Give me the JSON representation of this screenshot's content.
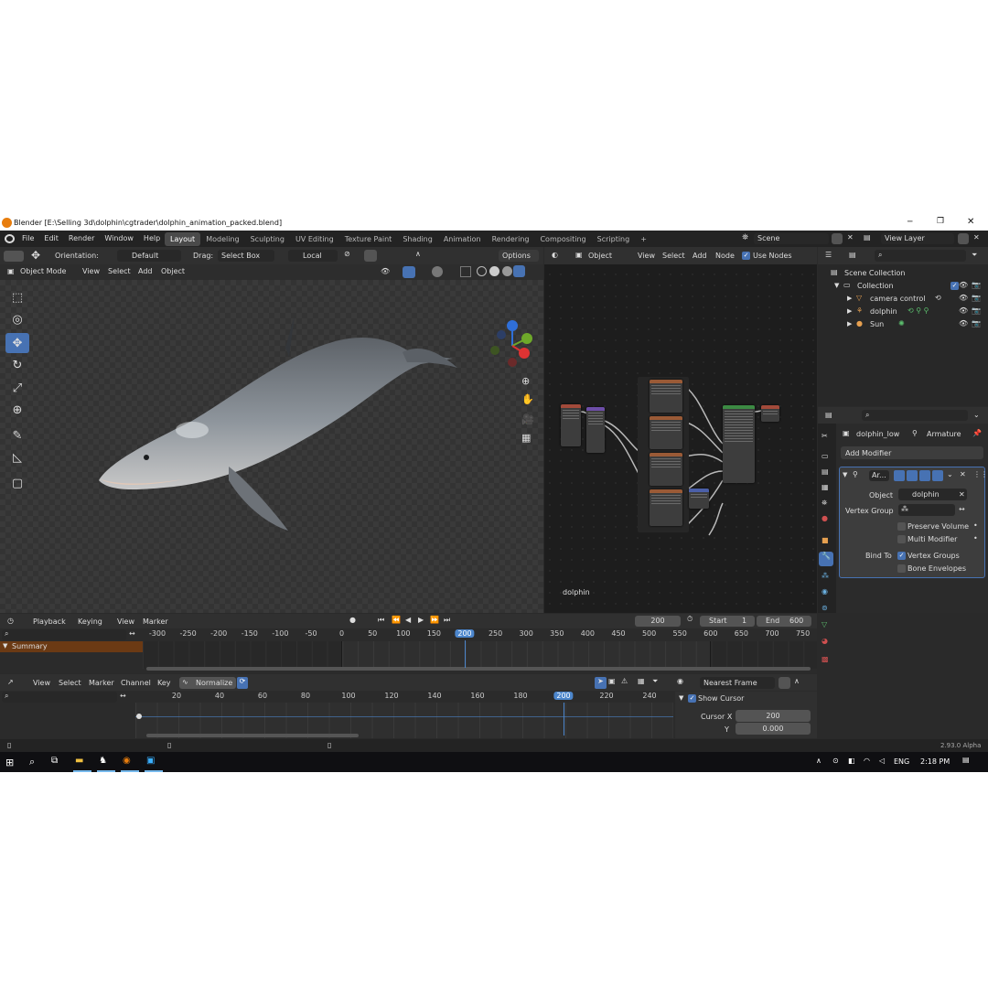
{
  "title_bar": {
    "title": "Blender [E:\\Selling 3d\\dolphin\\cgtrader\\dolphin_animation_packed.blend]"
  },
  "menu": [
    "File",
    "Edit",
    "Render",
    "Window",
    "Help"
  ],
  "workspaces": [
    "Layout",
    "Modeling",
    "Sculpting",
    "UV Editing",
    "Texture Paint",
    "Shading",
    "Animation",
    "Rendering",
    "Compositing",
    "Scripting"
  ],
  "scene": "Scene",
  "view_layer": "View Layer",
  "tool_header": {
    "orientation_label": "Orientation:",
    "orientation": "Default",
    "drag_label": "Drag:",
    "drag": "Select Box",
    "pivot": "Local",
    "options": "Options"
  },
  "viewport_header": {
    "mode": "Object Mode",
    "items": [
      "View",
      "Select",
      "Add",
      "Object"
    ]
  },
  "node_header": {
    "type": "Object",
    "items": [
      "View",
      "Select",
      "Add",
      "Node"
    ],
    "use_nodes": "Use Nodes"
  },
  "node_editor": {
    "label": "dolphin"
  },
  "outliner": {
    "root": "Scene Collection",
    "collection": "Collection",
    "items": [
      "camera control",
      "dolphin",
      "Sun"
    ]
  },
  "properties": {
    "object": "dolphin_low",
    "armature": "Armature",
    "add_modifier": "Add Modifier",
    "modifier_name": "Ar...",
    "object_label": "Object",
    "object_value": "dolphin",
    "vertex_group_label": "Vertex Group",
    "preserve_volume": "Preserve Volume",
    "multi_modifier": "Multi Modifier",
    "bind_to_label": "Bind To",
    "vertex_groups": "Vertex Groups",
    "bone_envelopes": "Bone Envelopes"
  },
  "timeline": {
    "menus": [
      "Playback",
      "Keying",
      "View",
      "Marker"
    ],
    "current_frame": "200",
    "start_label": "Start",
    "start": "1",
    "end_label": "End",
    "end": "600",
    "ticks": [
      "-300",
      "-250",
      "-200",
      "-150",
      "-100",
      "-50",
      "0",
      "50",
      "100",
      "150",
      "200",
      "250",
      "300",
      "350",
      "400",
      "450",
      "500",
      "550",
      "600",
      "650",
      "700",
      "750"
    ],
    "playhead": "200",
    "summary": "Summary"
  },
  "graph_editor": {
    "menus": [
      "View",
      "Select",
      "Marker",
      "Channel",
      "Key"
    ],
    "normalize": "Normalize",
    "snap": "Nearest Frame",
    "ticks": [
      "20",
      "40",
      "60",
      "80",
      "100",
      "120",
      "140",
      "160",
      "180",
      "200",
      "220",
      "240"
    ],
    "playhead": "200",
    "show_cursor": "Show Cursor",
    "cursor_x_label": "Cursor X",
    "cursor_x": "200",
    "cursor_y_label": "Y",
    "cursor_y": "0.000"
  },
  "status_bar": {
    "version": "2.93.0 Alpha"
  },
  "taskbar": {
    "lang": "ENG",
    "time": "2:18 PM"
  },
  "colors": {
    "accent": "#4772b3",
    "playhead": "#4c86cc",
    "outliner_bg": "#282828",
    "viewport_bg": "#3a3a3a"
  }
}
